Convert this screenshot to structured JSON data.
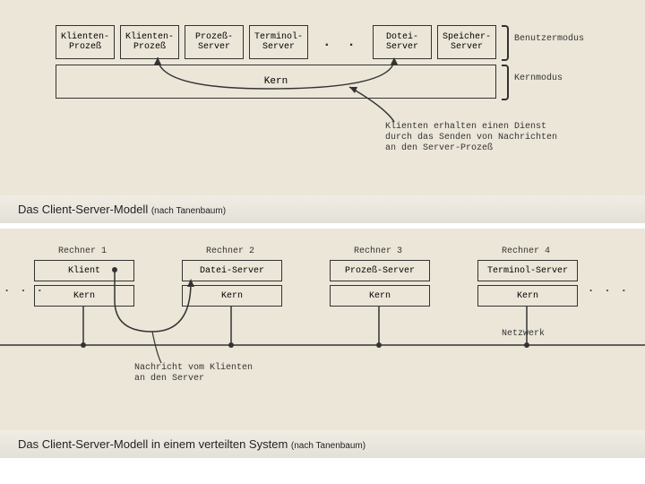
{
  "fig1": {
    "boxes": {
      "b1": "Klienten-\nProzeß",
      "b2": "Klienten-\nProzeß",
      "b3": "Prozeß-\nServer",
      "b4": "Terminol-\nServer",
      "b5": "Dotei-\nServer",
      "b6": "Speicher-\nServer",
      "kernel": "Kern",
      "ellipsis": ". . ."
    },
    "right": {
      "usermode": "Benutzermodus",
      "kernelmode": "Kernmodus"
    },
    "annotation": "Klienten erhalten einen Dienst\ndurch das Senden von Nachrichten\nan den Server-Prozeß",
    "caption": "Das Client-Server-Modell ",
    "caption_small": "(nach Tanenbaum)"
  },
  "fig2": {
    "headers": {
      "r1": "Rechner 1",
      "r2": "Rechner 2",
      "r3": "Rechner 3",
      "r4": "Rechner 4"
    },
    "top_boxes": {
      "r1": "Klient",
      "r2": "Datei-Server",
      "r3": "Prozeß-Server",
      "r4": "Terminol-Server"
    },
    "bottom_boxes": {
      "r1": "Kern",
      "r2": "Kern",
      "r3": "Kern",
      "r4": "Kern"
    },
    "network": "Netzwerk",
    "annotation": "Nachricht vom Klienten\nan den Server",
    "caption": "Das Client-Server-Modell in einem verteilten System ",
    "caption_small": "(nach Tanenbaum)",
    "ellipsis": ". . ."
  }
}
